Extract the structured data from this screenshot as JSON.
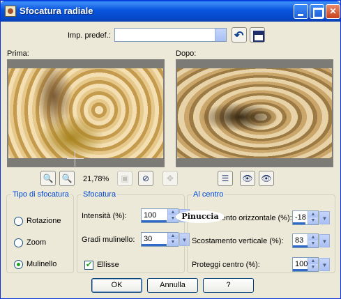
{
  "window": {
    "title": "Sfocatura radiale"
  },
  "presets": {
    "label": "Imp. predef.:",
    "value": ""
  },
  "previews": {
    "before_label": "Prima:",
    "after_label": "Dopo:"
  },
  "toolbar": {
    "zoom": "21,78%"
  },
  "blur_type": {
    "legend": "Tipo di sfocatura",
    "options": [
      "Rotazione",
      "Zoom",
      "Mulinello"
    ],
    "selected": "Mulinello"
  },
  "blur": {
    "legend": "Sfocatura",
    "intensity_label": "Intensità (%):",
    "intensity": "100",
    "twirl_label": "Gradi mulinello:",
    "twirl": "30",
    "ellipse_label": "Ellisse",
    "ellipse_checked": true
  },
  "center": {
    "legend": "Al centro",
    "h_offset_label": "Scostamento orizzontale (%):",
    "h_offset": "-18",
    "v_offset_label": "Scostamento verticale (%):",
    "v_offset": "83",
    "protect_label": "Proteggi centro (%):",
    "protect": "100"
  },
  "watermark": "Pinuccia",
  "buttons": {
    "ok": "OK",
    "cancel": "Annulla",
    "help": "?"
  },
  "colors": {
    "titlebar": "#0855dd",
    "group_legend": "#0046d5",
    "window_bg": "#ece9d8"
  }
}
